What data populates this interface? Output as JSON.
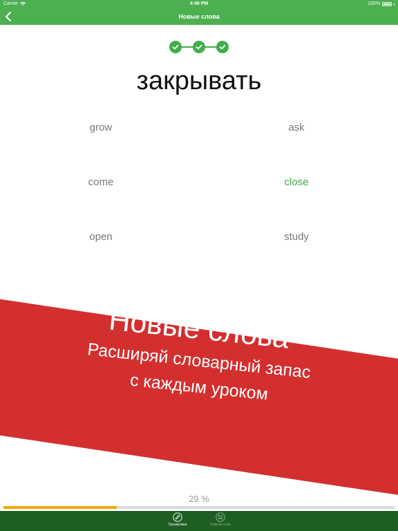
{
  "status_bar": {
    "carrier": "Carrier",
    "time": "4:48 PM",
    "battery": "100%"
  },
  "nav": {
    "title": "Новые слова"
  },
  "question": {
    "word": "закрывать"
  },
  "options": [
    {
      "label": "grow",
      "state": "normal"
    },
    {
      "label": "ask",
      "state": "normal"
    },
    {
      "label": "come",
      "state": "normal"
    },
    {
      "label": "close",
      "state": "correct"
    },
    {
      "label": "open",
      "state": "normal"
    },
    {
      "label": "study",
      "state": "normal"
    }
  ],
  "banner": {
    "title": "Новые слова",
    "subtitle_line1": "Расширяй словарный запас",
    "subtitle_line2": "с каждым уроком"
  },
  "progress": {
    "label": "29 %",
    "value": 0.29
  },
  "tabbar": {
    "tabs": [
      {
        "label": "Тренировка",
        "icon": "pencil-icon",
        "active": true
      },
      {
        "label": "Список слов",
        "icon": "word-list-icon",
        "active": false
      }
    ]
  },
  "colors": {
    "primary_green": "#4caf50",
    "correct_green": "#3fae49",
    "banner_red": "#d32f2f",
    "progress_orange": "#f4a300",
    "tabbar_green": "#1e5e23"
  }
}
